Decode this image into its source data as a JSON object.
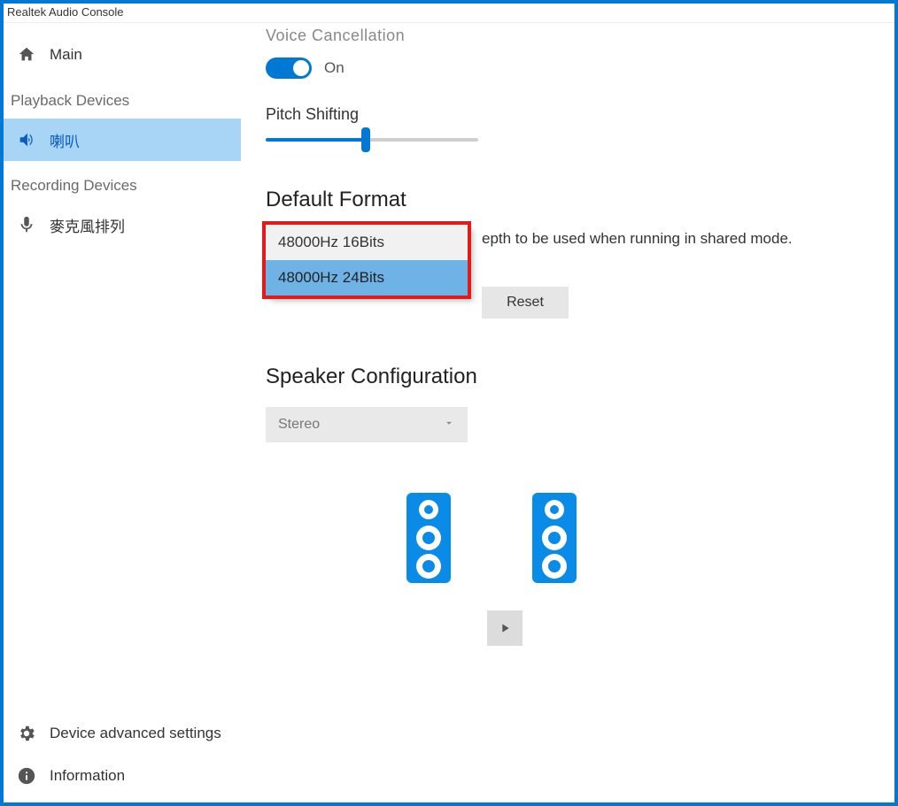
{
  "window": {
    "title": "Realtek Audio Console"
  },
  "sidebar": {
    "main": "Main",
    "playback_section": "Playback Devices",
    "playback_item": "喇叭",
    "recording_section": "Recording Devices",
    "recording_item": "麥克風排列",
    "advanced": "Device advanced settings",
    "information": "Information"
  },
  "main": {
    "voice_cancel_label": "Voice Cancellation",
    "voice_cancel_state": "On",
    "pitch_label": "Pitch Shifting",
    "default_format": {
      "heading": "Default Format",
      "description_trail": "epth to be used when running in shared mode.",
      "options": [
        "48000Hz 16Bits",
        "48000Hz 24Bits"
      ],
      "reset": "Reset"
    },
    "speaker_config": {
      "heading": "Speaker Configuration",
      "selected": "Stereo"
    }
  }
}
